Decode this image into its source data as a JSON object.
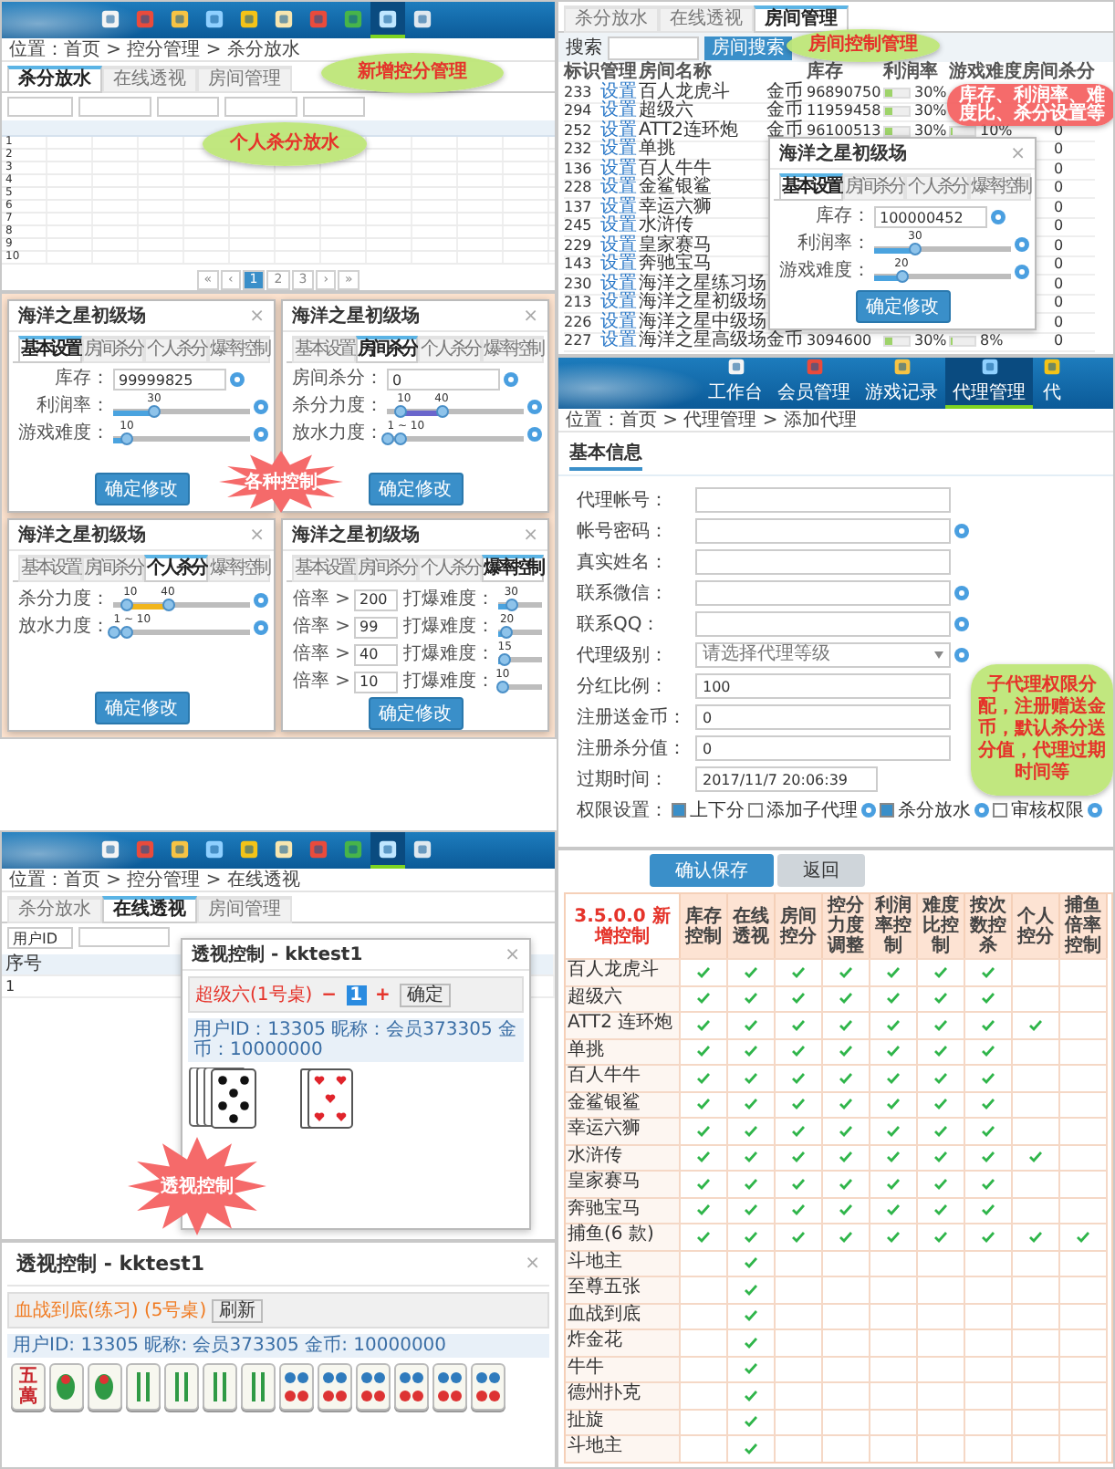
{
  "score_control": {
    "nav": [
      {
        "selected": false
      },
      {
        "selected": false
      },
      {
        "selected": false
      },
      {
        "selected": false
      },
      {
        "selected": false
      },
      {
        "selected": false
      },
      {
        "selected": false
      },
      {
        "selected": false
      },
      {
        "selected": true
      },
      {
        "selected": false
      }
    ],
    "breadcrumb": "位置：首页 > 控分管理 > 杀分放水",
    "tabs": [
      {
        "label": "杀分放水",
        "selected": true
      },
      {
        "label": "在线透视",
        "selected": false
      },
      {
        "label": "房间管理",
        "selected": false
      }
    ],
    "rows": [
      {
        "index": "1"
      },
      {
        "index": "2"
      },
      {
        "index": "3"
      },
      {
        "index": "4"
      },
      {
        "index": "5"
      },
      {
        "index": "6"
      },
      {
        "index": "7"
      },
      {
        "index": "8"
      },
      {
        "index": "9"
      },
      {
        "index": "10"
      }
    ],
    "pages": [
      {
        "label": "«",
        "selected": false
      },
      {
        "label": "‹",
        "selected": false
      },
      {
        "label": "1",
        "selected": true
      },
      {
        "label": "2",
        "selected": false
      },
      {
        "label": "3",
        "selected": false
      },
      {
        "label": "›",
        "selected": false
      },
      {
        "label": "»",
        "selected": false
      }
    ],
    "callouts": [
      {
        "text": "新增控分管理"
      },
      {
        "text": "个人杀分放水"
      }
    ]
  },
  "control_dialogs": {
    "badge": "各种控制",
    "dialogs": [
      {
        "kind": "basic",
        "title": "海洋之星初级场",
        "close": "×",
        "tabs": [
          {
            "label": "基本设置",
            "selected": true
          },
          {
            "label": "房间杀分",
            "selected": false
          },
          {
            "label": "个人杀分",
            "selected": false
          },
          {
            "label": "爆率控制",
            "selected": false
          }
        ],
        "input_label": "库存：",
        "input_value": "99999825",
        "sliders": [
          {
            "label": "利润率：",
            "value": "30",
            "level": 0.3
          },
          {
            "label": "游戏难度：",
            "value": "10",
            "level": 0.1
          }
        ],
        "button": "确定修改"
      },
      {
        "kind": "room",
        "title": "海洋之星初级场",
        "close": "×",
        "tabs": [
          {
            "label": "基本设置",
            "selected": false
          },
          {
            "label": "房间杀分",
            "selected": true
          },
          {
            "label": "个人杀分",
            "selected": false
          },
          {
            "label": "爆率控制",
            "selected": false
          }
        ],
        "input_label": "房间杀分：",
        "input_value": "0",
        "ranges": [
          {
            "label": "杀分力度：",
            "values": [
              "10",
              "40"
            ],
            "thumbs": [
              {
                "level": 0.1
              },
              {
                "level": 0.4
              }
            ]
          },
          {
            "label": "放水力度：",
            "values": [
              "1 ~ 10"
            ],
            "thumbs": [
              {
                "level": 0.01
              },
              {
                "level": 0.1
              }
            ]
          }
        ],
        "button": "确定修改"
      },
      {
        "kind": "personal",
        "title": "海洋之星初级场",
        "close": "×",
        "tabs": [
          {
            "label": "基本设置",
            "selected": false
          },
          {
            "label": "房间杀分",
            "selected": false
          },
          {
            "label": "个人杀分",
            "selected": true
          },
          {
            "label": "爆率控制",
            "selected": false
          }
        ],
        "ranges": [
          {
            "label": "杀分力度：",
            "values": [
              "10",
              "40"
            ],
            "thumbs": [
              {
                "level": 0.1
              },
              {
                "level": 0.4
              }
            ]
          },
          {
            "label": "放水力度：",
            "values": [
              "1 ~ 10"
            ],
            "thumbs": [
              {
                "level": 0.01
              },
              {
                "level": 0.1
              }
            ]
          }
        ],
        "button": "确定修改"
      },
      {
        "kind": "burst",
        "title": "海洋之星初级场",
        "close": "×",
        "tabs": [
          {
            "label": "基本设置",
            "selected": false
          },
          {
            "label": "房间杀分",
            "selected": false
          },
          {
            "label": "个人杀分",
            "selected": false
          },
          {
            "label": "爆率控制",
            "selected": true
          }
        ],
        "burst_rows": [
          {
            "label": "倍率 >",
            "input": "200",
            "slider_label": "打爆难度：",
            "value": "30",
            "level": 0.3
          },
          {
            "label": "倍率 >",
            "input": "99",
            "slider_label": "打爆难度：",
            "value": "20",
            "level": 0.2
          },
          {
            "label": "倍率 >",
            "input": "40",
            "slider_label": "打爆难度：",
            "value": "15",
            "level": 0.15
          },
          {
            "label": "倍率 >",
            "input": "10",
            "slider_label": "打爆难度：",
            "value": "10",
            "level": 0.1
          }
        ],
        "button": "确定修改"
      }
    ]
  },
  "view_control": {
    "nav": [
      {
        "selected": false
      },
      {
        "selected": false
      },
      {
        "selected": false
      },
      {
        "selected": false
      },
      {
        "selected": false
      },
      {
        "selected": false
      },
      {
        "selected": false
      },
      {
        "selected": false
      },
      {
        "selected": true
      },
      {
        "selected": false
      }
    ],
    "breadcrumb": "位置：首页 > 控分管理 > 在线透视",
    "tabs": [
      {
        "label": "杀分放水",
        "selected": false
      },
      {
        "label": "在线透视",
        "selected": true
      },
      {
        "label": "房间管理",
        "selected": false
      }
    ],
    "filter_select": "用户ID",
    "column": "序号",
    "row": "1",
    "dialog": {
      "title": "透视控制 - kktest1",
      "close": "×",
      "game": "超级六(1号桌)",
      "minus": "−",
      "count": "1",
      "plus": "+",
      "confirm": "确定",
      "player": "用户ID：13305 昵称：会员373305 金币：10000000"
    },
    "badge": "透视控制",
    "mahjong": {
      "title": "透视控制 - kktest1",
      "close": "×",
      "game": "血战到底(练习) (5号桌)",
      "refresh": "刷新",
      "player": "用户ID: 13305 昵称: 会员373305 金币: 10000000",
      "tiles": [
        {
          "kind": "character",
          "text": "五萬"
        },
        {
          "kind": "bird"
        },
        {
          "kind": "bird"
        },
        {
          "kind": "bamboo"
        },
        {
          "kind": "bamboo"
        },
        {
          "kind": "bamboo"
        },
        {
          "kind": "bamboo"
        },
        {
          "kind": "dots"
        },
        {
          "kind": "dots"
        },
        {
          "kind": "dots"
        },
        {
          "kind": "dots"
        },
        {
          "kind": "dots"
        },
        {
          "kind": "dots"
        }
      ]
    }
  },
  "room_management": {
    "tabs": [
      {
        "label": "杀分放水",
        "selected": false
      },
      {
        "label": "在线透视",
        "selected": false
      },
      {
        "label": "房间管理",
        "selected": true
      }
    ],
    "search_label": "搜索",
    "search_button": "房间搜索",
    "columns": [
      "标识",
      "管理",
      "房间名称",
      "库存",
      "利润率",
      "游戏难度",
      "房间杀分"
    ],
    "rows": [
      {
        "id": "233",
        "action": "设置",
        "name": "百人龙虎斗",
        "currency": "金币",
        "stock": "96890750",
        "profit": {
          "text": "30%",
          "level": 0.3
        }
      },
      {
        "id": "294",
        "action": "设置",
        "name": "超级六",
        "currency": "金币",
        "stock": "11959458",
        "profit": {
          "text": "30%",
          "level": 0.3
        }
      },
      {
        "id": "252",
        "action": "设置",
        "name": "ATT2连环炮",
        "currency": "金币",
        "stock": "96100513",
        "profit": {
          "text": "30%",
          "level": 0.3
        },
        "difficulty": {
          "text": "10%",
          "level": 0.1
        },
        "kill": "0"
      },
      {
        "id": "232",
        "action": "设置",
        "name": "单挑",
        "kill": "0"
      },
      {
        "id": "136",
        "action": "设置",
        "name": "百人牛牛",
        "kill": "0"
      },
      {
        "id": "228",
        "action": "设置",
        "name": "金鲨银鲨",
        "kill": "0"
      },
      {
        "id": "137",
        "action": "设置",
        "name": "幸运六狮",
        "kill": "0"
      },
      {
        "id": "245",
        "action": "设置",
        "name": "水浒传",
        "kill": "0"
      },
      {
        "id": "229",
        "action": "设置",
        "name": "皇家赛马",
        "kill": "0"
      },
      {
        "id": "143",
        "action": "设置",
        "name": "奔驰宝马",
        "kill": "0"
      },
      {
        "id": "230",
        "action": "设置",
        "name": "海洋之星练习场",
        "kill": "0"
      },
      {
        "id": "213",
        "action": "设置",
        "name": "海洋之星初级场",
        "kill": "0"
      },
      {
        "id": "226",
        "action": "设置",
        "name": "海洋之星中级场",
        "kill": "0"
      },
      {
        "id": "227",
        "action": "设置",
        "name": "海洋之星高级场",
        "currency": "金币",
        "stock": "3094600",
        "profit": {
          "text": "30%",
          "level": 0.3
        },
        "difficulty": {
          "text": "8%",
          "level": 0.08
        },
        "kill": "0"
      }
    ],
    "dialog": {
      "title": "海洋之星初级场",
      "close": "×",
      "tabs": [
        {
          "label": "基本设置",
          "selected": true
        },
        {
          "label": "房间杀分",
          "selected": false
        },
        {
          "label": "个人杀分",
          "selected": false
        },
        {
          "label": "爆率控制",
          "selected": false
        }
      ],
      "input_label": "库存：",
      "input_value": "100000452",
      "sliders": [
        {
          "label": "利润率：",
          "value": "30",
          "level": 0.3
        },
        {
          "label": "游戏难度：",
          "value": "20",
          "level": 0.2
        }
      ],
      "button": "确定修改"
    },
    "callouts": [
      {
        "kind": "tip",
        "text": "房间控制管理"
      },
      {
        "kind": "alert",
        "text": "库存、利润率、难度比、杀分设置等"
      }
    ]
  },
  "agent_form": {
    "nav": [
      {
        "label": "工作台",
        "selected": false
      },
      {
        "label": "会员管理",
        "selected": false
      },
      {
        "label": "游戏记录",
        "selected": false
      },
      {
        "label": "代理管理",
        "selected": true
      },
      {
        "label": "代",
        "selected": false
      }
    ],
    "breadcrumb": "位置：首页 > 代理管理 > 添加代理",
    "section": "基本信息",
    "fields": [
      {
        "kind": "text",
        "label": "代理帐号：",
        "help": false
      },
      {
        "kind": "text",
        "label": "帐号密码：",
        "help": true
      },
      {
        "kind": "text",
        "label": "真实姓名：",
        "help": false
      },
      {
        "kind": "text",
        "label": "联系微信：",
        "help": true
      },
      {
        "kind": "text",
        "label": "联系QQ：",
        "help": true
      },
      {
        "kind": "select",
        "label": "代理级别：",
        "placeholder": "请选择代理等级",
        "help": true
      },
      {
        "kind": "text",
        "label": "分红比例：",
        "value": "100",
        "help": false
      },
      {
        "kind": "text",
        "label": "注册送金币：",
        "value": "0",
        "help": false
      },
      {
        "kind": "text",
        "label": "注册杀分值：",
        "value": "0",
        "help": false
      },
      {
        "kind": "date",
        "label": "过期时间：",
        "value": "2017/11/7 20:06:39",
        "help": false
      }
    ],
    "permissions": {
      "label": "权限设置：",
      "items": [
        {
          "label": "上下分",
          "checked": true,
          "help": false
        },
        {
          "label": "添加子代理",
          "checked": false,
          "help": true
        },
        {
          "label": "杀分放水",
          "checked": true,
          "help": true
        },
        {
          "label": "审核权限",
          "checked": false,
          "help": true
        }
      ]
    },
    "callout": "子代理权限分配，注册赠送金币，默认杀分送分值，代理过期时间等"
  },
  "features": {
    "buttons": [
      {
        "kind": "primary",
        "label": "确认保存"
      },
      {
        "kind": "secondary",
        "label": "返回"
      }
    ],
    "corner": "3.5.0.0 新增控制",
    "columns": [
      "库存控制",
      "在线透视",
      "房间控分",
      "控分力度调整",
      "利润率控制",
      "难度比控制",
      "按次数控杀",
      "个人控分",
      "捕鱼倍率控制"
    ],
    "rows": [
      {
        "name": "百人龙虎斗",
        "checks": [
          true,
          true,
          true,
          true,
          true,
          true,
          true,
          false,
          false
        ]
      },
      {
        "name": "超级六",
        "checks": [
          true,
          true,
          true,
          true,
          true,
          true,
          true,
          false,
          false
        ]
      },
      {
        "name": "ATT2 连环炮",
        "checks": [
          true,
          true,
          true,
          true,
          true,
          true,
          true,
          true,
          false
        ]
      },
      {
        "name": "单挑",
        "checks": [
          true,
          true,
          true,
          true,
          true,
          true,
          true,
          false,
          false
        ]
      },
      {
        "name": "百人牛牛",
        "checks": [
          true,
          true,
          true,
          true,
          true,
          true,
          true,
          false,
          false
        ]
      },
      {
        "name": "金鲨银鲨",
        "checks": [
          true,
          true,
          true,
          true,
          true,
          true,
          true,
          false,
          false
        ]
      },
      {
        "name": "幸运六狮",
        "checks": [
          true,
          true,
          true,
          true,
          true,
          true,
          true,
          false,
          false
        ]
      },
      {
        "name": "水浒传",
        "checks": [
          true,
          true,
          true,
          true,
          true,
          true,
          true,
          true,
          false
        ]
      },
      {
        "name": "皇家赛马",
        "checks": [
          true,
          true,
          true,
          true,
          true,
          true,
          true,
          false,
          false
        ]
      },
      {
        "name": "奔驰宝马",
        "checks": [
          true,
          true,
          true,
          true,
          true,
          true,
          true,
          false,
          false
        ]
      },
      {
        "name": "捕鱼(6 款)",
        "checks": [
          true,
          true,
          true,
          true,
          true,
          true,
          true,
          true,
          true
        ]
      },
      {
        "name": "斗地主",
        "checks": [
          false,
          true,
          false,
          false,
          false,
          false,
          false,
          false,
          false
        ]
      },
      {
        "name": "至尊五张",
        "checks": [
          false,
          true,
          false,
          false,
          false,
          false,
          false,
          false,
          false
        ]
      },
      {
        "name": "血战到底",
        "checks": [
          false,
          true,
          false,
          false,
          false,
          false,
          false,
          false,
          false
        ]
      },
      {
        "name": "炸金花",
        "checks": [
          false,
          true,
          false,
          false,
          false,
          false,
          false,
          false,
          false
        ]
      },
      {
        "name": "牛牛",
        "checks": [
          false,
          true,
          false,
          false,
          false,
          false,
          false,
          false,
          false
        ]
      },
      {
        "name": "德州扑克",
        "checks": [
          false,
          true,
          false,
          false,
          false,
          false,
          false,
          false,
          false
        ]
      },
      {
        "name": "扯旋",
        "checks": [
          false,
          true,
          false,
          false,
          false,
          false,
          false,
          false,
          false
        ]
      },
      {
        "name": "斗地主",
        "checks": [
          false,
          true,
          false,
          false,
          false,
          false,
          false,
          false,
          false
        ]
      }
    ]
  }
}
